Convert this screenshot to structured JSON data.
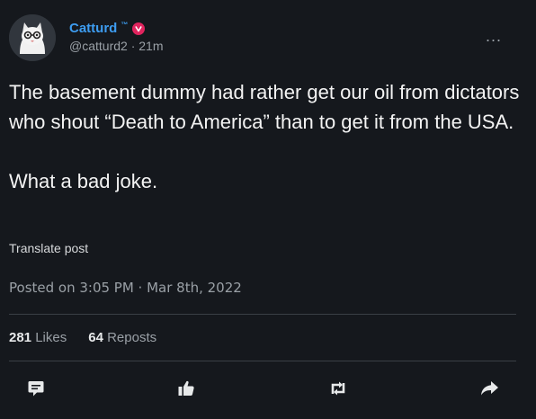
{
  "author": {
    "display_name": "Catturd",
    "tm": "™",
    "handle": "@catturd2",
    "separator": "·",
    "time_ago": "21m"
  },
  "menu": {
    "more_label": "..."
  },
  "post": {
    "paragraphs": [
      "The basement dummy had rather get our oil from dictators who shout “Death to America” than to get it from the USA.",
      "What a bad joke."
    ],
    "translate_label": "Translate post",
    "posted_text": "Posted on 3:05 PM · Mar 8th, 2022"
  },
  "stats": {
    "likes_count": "281",
    "likes_label": "Likes",
    "reposts_count": "64",
    "reposts_label": "Reposts"
  },
  "colors": {
    "background": "#15181d",
    "accent": "#3d9cf0",
    "badge": "#e0245e"
  },
  "icons": [
    "comment-icon",
    "like-icon",
    "repost-icon",
    "share-icon",
    "verified-badge-icon"
  ]
}
